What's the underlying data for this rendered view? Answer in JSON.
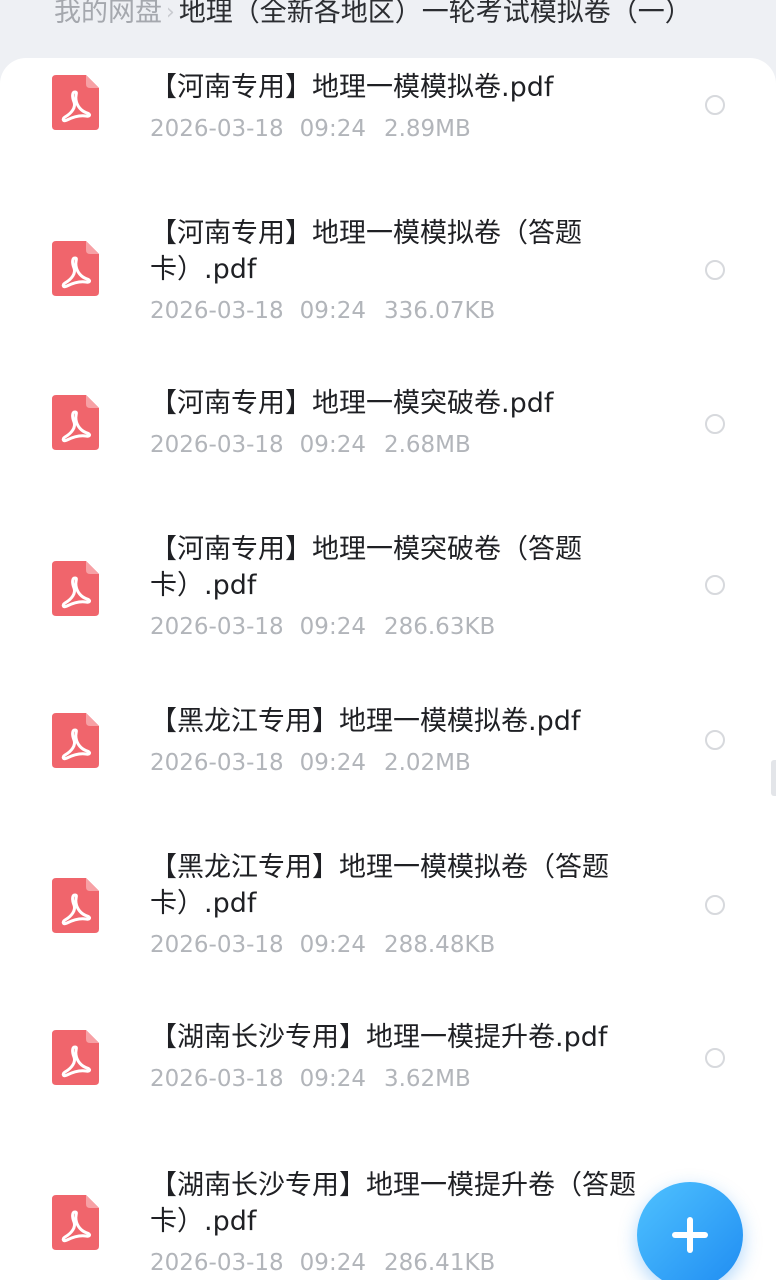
{
  "breadcrumb": {
    "root": "我的网盘",
    "separator": "›",
    "current": "地理（全新各地区）一轮考试模拟卷（一）"
  },
  "colors": {
    "pdf_icon": "#f0656c",
    "fab_start": "#4fc2ff",
    "fab_end": "#1f8cf2",
    "meta_text": "#b2b5ba"
  },
  "files": [
    {
      "name": "【河南专用】地理一模模拟卷.pdf",
      "date": "2026-03-18",
      "time": "09:24",
      "size": "2.89MB",
      "icon": "pdf-file-icon"
    },
    {
      "name": "【河南专用】地理一模模拟卷（答题卡）.pdf",
      "date": "2026-03-18",
      "time": "09:24",
      "size": "336.07KB",
      "icon": "pdf-file-icon"
    },
    {
      "name": "【河南专用】地理一模突破卷.pdf",
      "date": "2026-03-18",
      "time": "09:24",
      "size": "2.68MB",
      "icon": "pdf-file-icon"
    },
    {
      "name": "【河南专用】地理一模突破卷（答题卡）.pdf",
      "date": "2026-03-18",
      "time": "09:24",
      "size": "286.63KB",
      "icon": "pdf-file-icon"
    },
    {
      "name": "【黑龙江专用】地理一模模拟卷.pdf",
      "date": "2026-03-18",
      "time": "09:24",
      "size": "2.02MB",
      "icon": "pdf-file-icon"
    },
    {
      "name": "【黑龙江专用】地理一模模拟卷（答题卡）.pdf",
      "date": "2026-03-18",
      "time": "09:24",
      "size": "288.48KB",
      "icon": "pdf-file-icon"
    },
    {
      "name": "【湖南长沙专用】地理一模提升卷.pdf",
      "date": "2026-03-18",
      "time": "09:24",
      "size": "3.62MB",
      "icon": "pdf-file-icon"
    },
    {
      "name": "【湖南长沙专用】地理一模提升卷（答题卡）.pdf",
      "date": "2026-03-18",
      "time": "09:24",
      "size": "286.41KB",
      "icon": "pdf-file-icon"
    }
  ],
  "fab": {
    "icon": "plus-icon"
  }
}
